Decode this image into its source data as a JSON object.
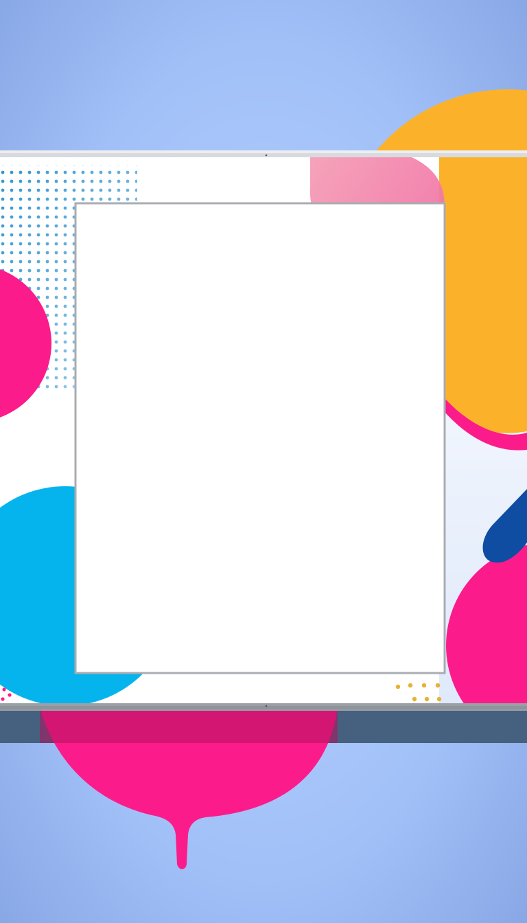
{
  "palette": {
    "background_light": "#aac9fb",
    "background_dark": "#7f9de0",
    "frame_silver": "#b5b8bd",
    "frame_shadow": "#46617f",
    "panel_white": "#ffffff",
    "hot_pink": "#fc1b8b",
    "cyan": "#05b4ec",
    "amber": "#fbb22a",
    "navy": "#0e4da1",
    "soft_pink": "#f587ad",
    "dot_blue": "#2e95d1",
    "dot_gold": "#e9b133"
  },
  "content": {
    "text": []
  }
}
